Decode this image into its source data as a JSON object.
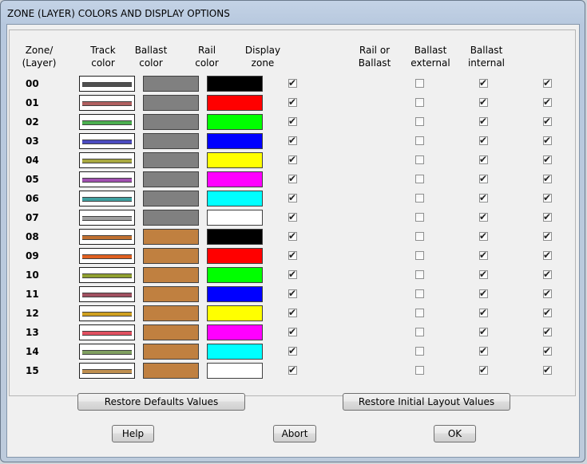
{
  "window": {
    "title": "ZONE (LAYER) COLORS AND DISPLAY OPTIONS"
  },
  "headers": {
    "zone": "Zone/\n(Layer)",
    "track": "Track\ncolor",
    "ballast": "Ballast\ncolor",
    "rail": "Rail\ncolor",
    "display": "Display\nzone",
    "rail_or_ballast": "Rail or\nBallast",
    "ballast_external": "Ballast\nexternal",
    "ballast_internal": "Ballast\ninternal"
  },
  "zones": [
    {
      "label": "00",
      "track": "#505050",
      "ballast": "#808080",
      "rail": "#000000",
      "display": true,
      "rail_or_ballast": false,
      "ballast_external": true,
      "ballast_internal": true
    },
    {
      "label": "01",
      "track": "#b06060",
      "ballast": "#808080",
      "rail": "#ff0000",
      "display": true,
      "rail_or_ballast": false,
      "ballast_external": true,
      "ballast_internal": true
    },
    {
      "label": "02",
      "track": "#4caf50",
      "ballast": "#808080",
      "rail": "#00ff00",
      "display": true,
      "rail_or_ballast": false,
      "ballast_external": true,
      "ballast_internal": true
    },
    {
      "label": "03",
      "track": "#4b4bc0",
      "ballast": "#808080",
      "rail": "#0000ff",
      "display": true,
      "rail_or_ballast": false,
      "ballast_external": true,
      "ballast_internal": true
    },
    {
      "label": "04",
      "track": "#a8a840",
      "ballast": "#808080",
      "rail": "#ffff00",
      "display": true,
      "rail_or_ballast": false,
      "ballast_external": true,
      "ballast_internal": true
    },
    {
      "label": "05",
      "track": "#a050b0",
      "ballast": "#808080",
      "rail": "#ff00ff",
      "display": true,
      "rail_or_ballast": false,
      "ballast_external": true,
      "ballast_internal": true
    },
    {
      "label": "06",
      "track": "#40a0a0",
      "ballast": "#808080",
      "rail": "#00ffff",
      "display": true,
      "rail_or_ballast": false,
      "ballast_external": true,
      "ballast_internal": true
    },
    {
      "label": "07",
      "track": "#a0a0a0",
      "ballast": "#808080",
      "rail": "#ffffff",
      "display": true,
      "rail_or_ballast": false,
      "ballast_external": true,
      "ballast_internal": true
    },
    {
      "label": "08",
      "track": "#c07030",
      "ballast": "#c08040",
      "rail": "#000000",
      "display": true,
      "rail_or_ballast": false,
      "ballast_external": true,
      "ballast_internal": true
    },
    {
      "label": "09",
      "track": "#e06020",
      "ballast": "#c08040",
      "rail": "#ff0000",
      "display": true,
      "rail_or_ballast": false,
      "ballast_external": true,
      "ballast_internal": true
    },
    {
      "label": "10",
      "track": "#90a030",
      "ballast": "#c08040",
      "rail": "#00ff00",
      "display": true,
      "rail_or_ballast": false,
      "ballast_external": true,
      "ballast_internal": true
    },
    {
      "label": "11",
      "track": "#a05060",
      "ballast": "#c08040",
      "rail": "#0000ff",
      "display": true,
      "rail_or_ballast": false,
      "ballast_external": true,
      "ballast_internal": true
    },
    {
      "label": "12",
      "track": "#d0a020",
      "ballast": "#c08040",
      "rail": "#ffff00",
      "display": true,
      "rail_or_ballast": false,
      "ballast_external": true,
      "ballast_internal": true
    },
    {
      "label": "13",
      "track": "#e05060",
      "ballast": "#c08040",
      "rail": "#ff00ff",
      "display": true,
      "rail_or_ballast": false,
      "ballast_external": true,
      "ballast_internal": true
    },
    {
      "label": "14",
      "track": "#80a060",
      "ballast": "#c08040",
      "rail": "#00ffff",
      "display": true,
      "rail_or_ballast": false,
      "ballast_external": true,
      "ballast_internal": true
    },
    {
      "label": "15",
      "track": "#c09050",
      "ballast": "#c08040",
      "rail": "#ffffff",
      "display": true,
      "rail_or_ballast": false,
      "ballast_external": true,
      "ballast_internal": true
    }
  ],
  "buttons": {
    "restore_defaults": "Restore Defaults Values",
    "restore_initial": "Restore Initial Layout Values",
    "help": "Help",
    "abort": "Abort",
    "ok": "OK"
  }
}
